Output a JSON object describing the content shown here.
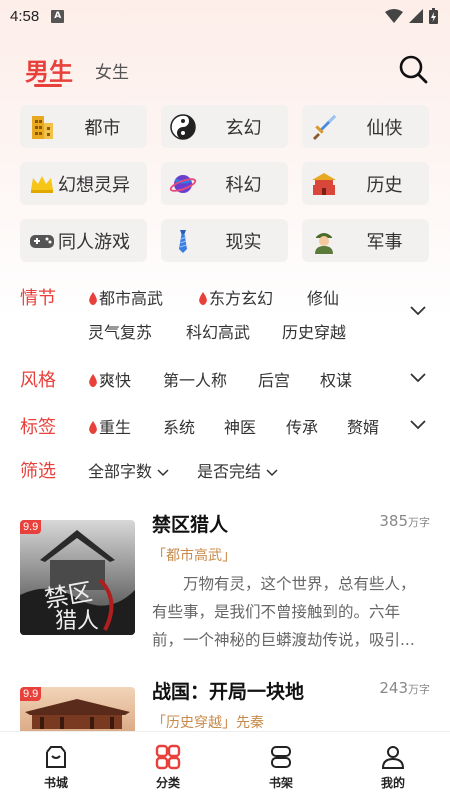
{
  "status": {
    "time": "4:58",
    "notif_badge": "A"
  },
  "tabs": {
    "male": "男生",
    "female": "女生",
    "active": "male"
  },
  "categories": [
    {
      "label": "都市",
      "icon": "building-icon"
    },
    {
      "label": "玄幻",
      "icon": "yin-yang-icon"
    },
    {
      "label": "仙侠",
      "icon": "sword-icon"
    },
    {
      "label": "幻想灵异",
      "icon": "crown-icon"
    },
    {
      "label": "科幻",
      "icon": "planet-icon"
    },
    {
      "label": "历史",
      "icon": "palace-icon"
    },
    {
      "label": "同人游戏",
      "icon": "gamepad-icon"
    },
    {
      "label": "现实",
      "icon": "necktie-icon"
    },
    {
      "label": "军事",
      "icon": "soldier-icon"
    }
  ],
  "filters": {
    "plot": {
      "key": "情节",
      "chips": [
        "都市高武",
        "东方玄幻",
        "修仙",
        "灵气复苏",
        "科幻高武",
        "历史穿越"
      ]
    },
    "style": {
      "key": "风格",
      "chips": [
        "爽快",
        "第一人称",
        "后宫",
        "权谋"
      ]
    },
    "tags": {
      "key": "标签",
      "chips": [
        "重生",
        "系统",
        "神医",
        "传承",
        "赘婿"
      ]
    },
    "sift": {
      "key": "筛选",
      "chips": [
        "全部字数",
        "是否完结"
      ]
    }
  },
  "books": [
    {
      "badge": "9.9",
      "title": "禁区猎人",
      "words": "385",
      "words_unit": "万字",
      "tag": "「都市高武」",
      "desc": "万物有灵，这个世界，总有些人，有些事，是我们不曾接触到的。六年前，一个神秘的巨蟒渡劫传说，吸引..."
    },
    {
      "badge": "9.9",
      "title": "战国：开局一块地",
      "words": "243",
      "words_unit": "万字",
      "tag": "「历史穿越」先秦"
    }
  ],
  "nav": [
    {
      "label": "书城",
      "icon": "bookstore-icon"
    },
    {
      "label": "分类",
      "icon": "category-icon"
    },
    {
      "label": "书架",
      "icon": "bookshelf-icon"
    },
    {
      "label": "我的",
      "icon": "profile-icon"
    }
  ],
  "colors": {
    "accent": "#e8413b",
    "tag": "#c88a4a",
    "chip_bg": "#f3f1f0"
  }
}
